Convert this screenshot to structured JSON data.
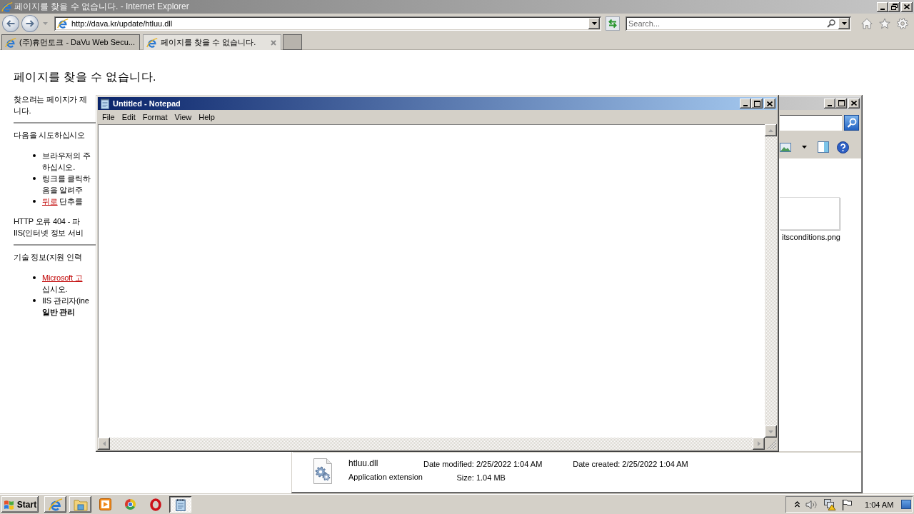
{
  "browser": {
    "title": "페이지를 찾을 수 없습니다. - Internet Explorer",
    "address": "http://dava.kr/update/htluu.dll",
    "search": {
      "placeholder": "Search..."
    },
    "tabs": [
      {
        "label": "(주)휴먼토크 - DaVu Web Secu...",
        "selected": false
      },
      {
        "label": "페이지를 찾을 수 없습니다.",
        "selected": true
      }
    ],
    "page": {
      "heading": "페이지를 찾을 수 없습니다.",
      "blocks": [
        {
          "kind": "paragraph",
          "lines": [
            [
              {
                "kind": "text",
                "text": "찾으려는 페이지가 제"
              }
            ],
            [
              {
                "kind": "text",
                "text": "니다."
              }
            ]
          ]
        },
        {
          "kind": "rule"
        },
        {
          "kind": "paragraph",
          "lines": [
            [
              {
                "kind": "text",
                "text": "다음을 시도하십시오"
              }
            ]
          ]
        },
        {
          "kind": "list",
          "items": [
            {
              "lines": [
                [
                  {
                    "kind": "text",
                    "text": "브라우저의 주"
                  }
                ],
                [
                  {
                    "kind": "text",
                    "text": "하십시오."
                  }
                ]
              ]
            },
            {
              "lines": [
                [
                  {
                    "kind": "text",
                    "text": "링크를 클릭하"
                  }
                ],
                [
                  {
                    "kind": "text",
                    "text": "음을 알려주"
                  }
                ]
              ]
            },
            {
              "lines": [
                [
                  {
                    "kind": "link",
                    "text": "뒤로"
                  },
                  {
                    "kind": "text",
                    "text": "단추를"
                  }
                ]
              ]
            }
          ]
        },
        {
          "kind": "paragraph",
          "lines": [
            [
              {
                "kind": "text",
                "text": "HTTP 오류 404 - 파"
              }
            ],
            [
              {
                "kind": "text",
                "text": "IIS(인터넷 정보 서비"
              }
            ]
          ]
        },
        {
          "kind": "rule"
        },
        {
          "kind": "paragraph",
          "lines": [
            [
              {
                "kind": "text",
                "text": "기술 정보(지원 인력"
              }
            ]
          ]
        },
        {
          "kind": "list",
          "items": [
            {
              "lines": [
                [
                  {
                    "kind": "link",
                    "text": "Microsoft 고"
                  }
                ],
                [
                  {
                    "kind": "text",
                    "text": "십시오."
                  }
                ]
              ]
            },
            {
              "lines": [
                [
                  {
                    "kind": "text",
                    "text": "IIS 관리자(ine"
                  }
                ],
                [
                  {
                    "kind": "bold",
                    "text": "일반 관리"
                  }
                ]
              ]
            }
          ]
        }
      ]
    }
  },
  "explorer": {
    "thumbnail_label": "itsconditions.png",
    "details": {
      "name": "htluu.dll",
      "type": "Application extension",
      "fields": [
        {
          "label": "Date modified:",
          "value": "2/25/2022 1:04 AM"
        },
        {
          "label": "Size:",
          "value": "1.04 MB"
        },
        {
          "label": "Date created:",
          "value": "2/25/2022 1:04 AM"
        }
      ]
    }
  },
  "notepad": {
    "title": "Untitled - Notepad",
    "menu": [
      "File",
      "Edit",
      "Format",
      "View",
      "Help"
    ]
  },
  "taskbar": {
    "start": "Start",
    "apps": [
      {
        "kind": "elogo",
        "running": true,
        "selected": false
      },
      {
        "kind": "folder",
        "running": true,
        "selected": false
      },
      {
        "kind": "player",
        "running": false,
        "selected": false
      },
      {
        "kind": "wheel",
        "running": false,
        "selected": false
      },
      {
        "kind": "ring",
        "running": false,
        "selected": false
      },
      {
        "kind": "notepad",
        "running": true,
        "selected": true
      }
    ],
    "clock": "1:04 AM"
  }
}
